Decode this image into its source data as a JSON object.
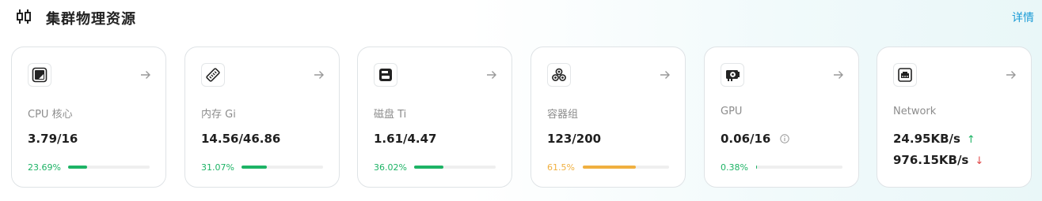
{
  "header": {
    "title": "集群物理资源",
    "details_label": "详情",
    "link_color": "#1a9bd6"
  },
  "cards": [
    {
      "icon": "cpu-chip-icon",
      "label": "CPU 核心",
      "value": "3.79/16",
      "percent": "23.69%",
      "progress": 0.2369,
      "color": "#1db365"
    },
    {
      "icon": "memory-stick-icon",
      "label": "内存 Gi",
      "value": "14.56/46.86",
      "percent": "31.07%",
      "progress": 0.3107,
      "color": "#1db365"
    },
    {
      "icon": "hard-disk-icon",
      "label": "磁盘 Ti",
      "value": "1.61/4.47",
      "percent": "36.02%",
      "progress": 0.3602,
      "color": "#1db365"
    },
    {
      "icon": "pod-group-icon",
      "label": "容器组",
      "value": "123/200",
      "percent": "61.5%",
      "progress": 0.615,
      "color": "#f0b040"
    },
    {
      "icon": "gpu-card-icon",
      "label": "GPU",
      "value": "0.06/16",
      "percent": "0.38%",
      "progress": 0.0038,
      "color": "#1db365"
    },
    {
      "icon": "network-port-icon",
      "label": "Network",
      "upload": "24.95KB/s",
      "download": "976.15KB/s",
      "up_color": "#1db365",
      "down_color": "#e04848"
    }
  ]
}
